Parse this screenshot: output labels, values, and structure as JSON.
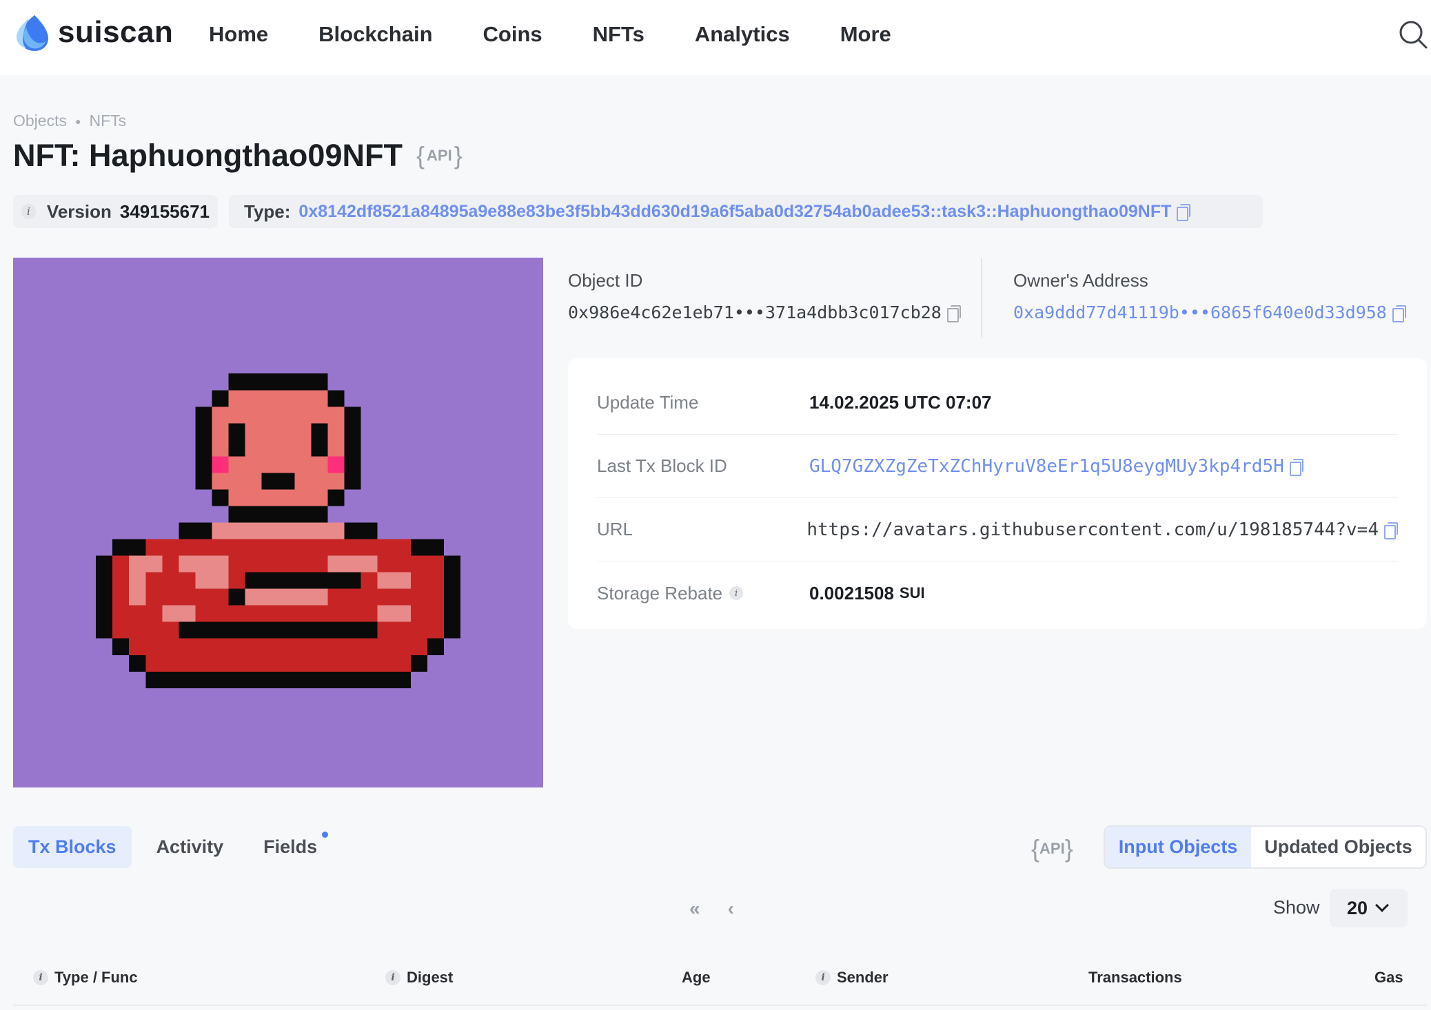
{
  "header": {
    "brand": "suiscan",
    "nav": [
      "Home",
      "Blockchain",
      "Coins",
      "NFTs",
      "Analytics",
      "More"
    ]
  },
  "breadcrumb": [
    "Objects",
    "NFTs"
  ],
  "title": "NFT: Haphuongthao09NFT",
  "api_label": "API",
  "version": {
    "label": "Version",
    "value": "349155671"
  },
  "type": {
    "label": "Type:",
    "value": "0x8142df8521a84895a9e88e83be3f5bb43dd630d19a6f5aba0d32754ab0adee53::task3::Haphuongthao09NFT"
  },
  "object_id": {
    "label": "Object ID",
    "value": "0x986e4c62e1eb71•••371a4dbb3c017cb28"
  },
  "owner": {
    "label": "Owner's Address",
    "value": "0xa9ddd77d41119b•••6865f640e0d33d958"
  },
  "details": {
    "update_time": {
      "label": "Update Time",
      "value": "14.02.2025 UTC 07:07"
    },
    "last_tx": {
      "label": "Last Tx Block ID",
      "value": "GLQ7GZXZgZeTxZChHyruV8eEr1q5U8eygMUy3kp4rd5H"
    },
    "url": {
      "label": "URL",
      "value": "https://avatars.githubusercontent.com/u/198185744?v=4"
    },
    "storage_rebate": {
      "label": "Storage Rebate",
      "value": "0.0021508",
      "unit": "SUI"
    }
  },
  "tabs": [
    "Tx Blocks",
    "Activity",
    "Fields"
  ],
  "segment": [
    "Input Objects",
    "Updated Objects"
  ],
  "pager": {
    "first": "«",
    "prev": "‹"
  },
  "show": {
    "label": "Show",
    "value": "20"
  },
  "table_headers": [
    "Type / Func",
    "Digest",
    "Age",
    "Sender",
    "Transactions",
    "Gas"
  ],
  "colors": {
    "accent": "#4f7cf0",
    "link": "#6f8ff0",
    "nft_bg": "#9876ce"
  }
}
